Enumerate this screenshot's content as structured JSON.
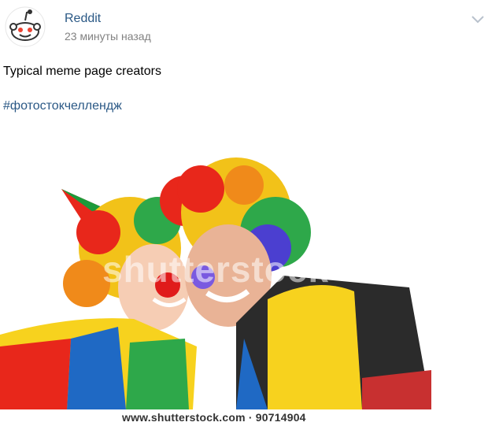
{
  "post": {
    "author": "Reddit",
    "time": "23 минуты назад",
    "text": "Typical meme page creators",
    "hashtag": "#фотостокчеллендж"
  },
  "image": {
    "watermark": "shutterstock",
    "caption": "www.shutterstock.com · 90714904"
  },
  "icons": {
    "avatar": "reddit-alien-icon",
    "menu": "chevron-down-icon"
  },
  "colors": {
    "link": "#2a5885",
    "secondary": "#828282"
  }
}
